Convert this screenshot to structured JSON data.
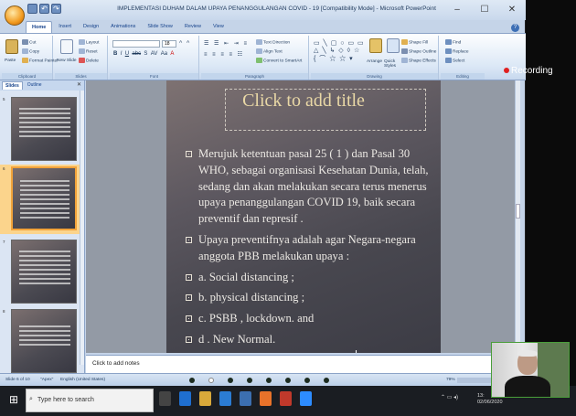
{
  "window": {
    "title": "IMPLEMENTASI DUHAM DALAM UPAYA PENANGGULANGAN COVID - 19 [Compatibility Mode] - Microsoft PowerPoint"
  },
  "ribbon_tabs": [
    "Home",
    "Insert",
    "Design",
    "Animations",
    "Slide Show",
    "Review",
    "View"
  ],
  "ribbon": {
    "clipboard": {
      "paste": "Paste",
      "cut": "Cut",
      "copy": "Copy",
      "format_painter": "Format Painter",
      "label": "Clipboard"
    },
    "slides": {
      "new_slide": "New Slide",
      "layout": "Layout",
      "reset": "Reset",
      "delete": "Delete",
      "label": "Slides"
    },
    "font": {
      "label": "Font",
      "size": "18"
    },
    "paragraph": {
      "text_direction": "Text Direction",
      "align_text": "Align Text",
      "convert": "Convert to SmartArt",
      "label": "Paragraph"
    },
    "drawing": {
      "arrange": "Arrange",
      "quick_styles": "Quick Styles",
      "shape_fill": "Shape Fill",
      "shape_outline": "Shape Outline",
      "shape_effects": "Shape Effects",
      "label": "Drawing"
    },
    "editing": {
      "find": "Find",
      "replace": "Replace",
      "select": "Select",
      "label": "Editing"
    }
  },
  "recording": "Recording",
  "panel": {
    "tabs": [
      "Slides",
      "Outline"
    ],
    "slide_numbers": [
      "5",
      "6",
      "7",
      "8"
    ]
  },
  "slide": {
    "title_placeholder": "Click to add title",
    "bullets": [
      "Merujuk ketentuan pasal 25 ( 1 ) dan Pasal 30 WHO, sebagai organisasi Kesehatan Dunia, telah, sedang dan akan melakukan secara terus menerus upaya penanggulangan COVID 19, baik secara preventif dan represif .",
      "Upaya preventifnya adalah agar Negara-negara anggota PBB melakukan upaya :",
      "a. Social distancing ;",
      "b. physical distancing ;",
      "c. PSBB , lockdown. and",
      "d . New Normal."
    ]
  },
  "notes_placeholder": "Click to add notes",
  "status": {
    "slide_info": "Slide 6 of 10",
    "theme": "\"Apex\"",
    "language": "English (United States)",
    "zoom": "79%"
  },
  "taskbar": {
    "search_placeholder": "Type here to search",
    "time": "13:",
    "date": "02/06/2020"
  },
  "colors": {
    "title_text": "#e9d8a6",
    "body_text": "#ece9e4",
    "selected_thumb": "#f2a33a"
  }
}
